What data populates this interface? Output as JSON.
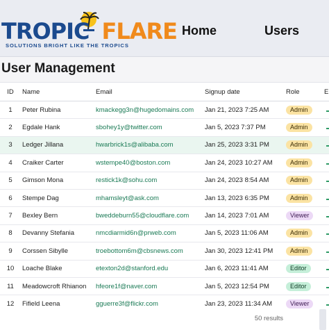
{
  "brand": {
    "name_part1": "TROPIC",
    "name_part2": "FLARE",
    "tagline": "SOLUTIONS BRIGHT LIKE THE TROPICS"
  },
  "nav": {
    "home": "Home",
    "users": "Users"
  },
  "page": {
    "title": "User Management"
  },
  "table": {
    "columns": {
      "id": "ID",
      "name": "Name",
      "email": "Email",
      "signup": "Signup date",
      "role": "Role",
      "extra": "E"
    },
    "rows": [
      {
        "id": "1",
        "name": "Peter Rubina",
        "email": "kmackegg3n@hugedomains.com",
        "signup": "Jan 21, 2023 7:25 AM",
        "role": "Admin"
      },
      {
        "id": "2",
        "name": "Egdale Hank",
        "email": "sbohey1y@twitter.com",
        "signup": "Jan 5, 2023 7:37 PM",
        "role": "Admin"
      },
      {
        "id": "3",
        "name": "Ledger Jillana",
        "email": "hwarbrick1s@alibaba.com",
        "signup": "Jan 25, 2023 3:31 PM",
        "role": "Admin"
      },
      {
        "id": "4",
        "name": "Craiker Carter",
        "email": "wstempe40@boston.com",
        "signup": "Jan 24, 2023 10:27 AM",
        "role": "Admin"
      },
      {
        "id": "5",
        "name": "Gimson Mona",
        "email": "restick1k@sohu.com",
        "signup": "Jan 24, 2023 8:54 AM",
        "role": "Admin"
      },
      {
        "id": "6",
        "name": "Stempe Dag",
        "email": "mhamsleyt@ask.com",
        "signup": "Jan 13, 2023 6:35 PM",
        "role": "Admin"
      },
      {
        "id": "7",
        "name": "Bexley Bern",
        "email": "bweddeburn55@cloudflare.com",
        "signup": "Jan 14, 2023 7:01 AM",
        "role": "Viewer"
      },
      {
        "id": "8",
        "name": "Devanny Stefania",
        "email": "nmcdiarmid6n@prweb.com",
        "signup": "Jan 5, 2023 11:06 AM",
        "role": "Admin"
      },
      {
        "id": "9",
        "name": "Corssen Sibylle",
        "email": "troebottom6m@cbsnews.com",
        "signup": "Jan 30, 2023 12:41 PM",
        "role": "Admin"
      },
      {
        "id": "10",
        "name": "Loache Blake",
        "email": "etexton2d@stanford.edu",
        "signup": "Jan 6, 2023 11:41 AM",
        "role": "Editor"
      },
      {
        "id": "11",
        "name": "Meadowcroft Rhianon",
        "email": "hfeore1f@naver.com",
        "signup": "Jan 5, 2023 12:54 PM",
        "role": "Editor"
      },
      {
        "id": "12",
        "name": "Fifield Leena",
        "email": "gguerre3f@flickr.com",
        "signup": "Jan 23, 2023 11:34 AM",
        "role": "Viewer"
      }
    ],
    "highlighted_row": 3,
    "results_text": "50 results"
  },
  "colors": {
    "brand_blue": "#1b4a8e",
    "brand_orange": "#f08a1c",
    "email_green": "#1a7a55",
    "admin_badge": "#fbe3a3",
    "viewer_badge": "#ecd9f6",
    "editor_badge": "#c5efd9"
  },
  "icons": {
    "logo": "palm-tree-sun-icon"
  }
}
